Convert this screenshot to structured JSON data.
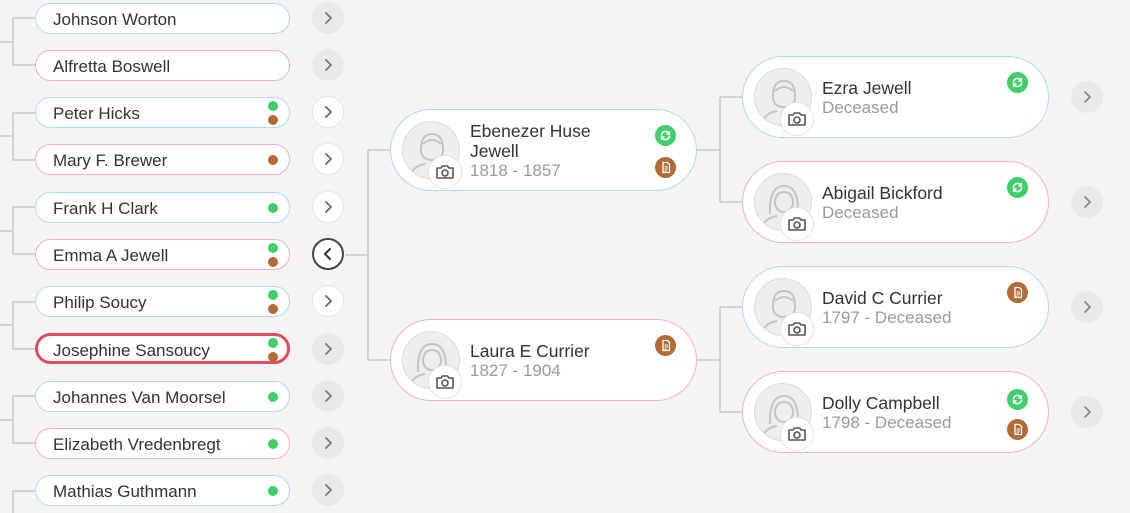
{
  "left_list": [
    {
      "name": "Johnson Worton",
      "gender": "male",
      "dots": [],
      "chevron": "gray"
    },
    {
      "name": "Alfretta Boswell",
      "gender": "female",
      "dots": [],
      "chevron": "gray"
    },
    {
      "name": "Peter Hicks",
      "gender": "male",
      "dots": [
        "green",
        "brown"
      ],
      "chevron": "white"
    },
    {
      "name": "Mary F. Brewer",
      "gender": "female",
      "dots": [
        "brown"
      ],
      "chevron": "white"
    },
    {
      "name": "Frank H Clark",
      "gender": "male",
      "dots": [
        "green"
      ],
      "chevron": "white"
    },
    {
      "name": "Emma A Jewell",
      "gender": "female",
      "dots": [
        "green",
        "brown"
      ],
      "chevron": "active"
    },
    {
      "name": "Philip Soucy",
      "gender": "male",
      "dots": [
        "green",
        "brown"
      ],
      "chevron": "white"
    },
    {
      "name": "Josephine Sansoucy",
      "gender": "female",
      "dots": [
        "green",
        "brown"
      ],
      "chevron": "gray",
      "selected": true
    },
    {
      "name": "Johannes Van Moorsel",
      "gender": "male",
      "dots": [
        "green"
      ],
      "chevron": "gray"
    },
    {
      "name": "Elizabeth Vredenbregt",
      "gender": "female",
      "dots": [
        "green"
      ],
      "chevron": "gray"
    },
    {
      "name": "Mathias Guthmann",
      "gender": "male",
      "dots": [
        "green"
      ],
      "chevron": "gray"
    }
  ],
  "parents": {
    "father": {
      "name": "Ebenezer Huse Jewell",
      "dates": "1818 - 1857"
    },
    "mother": {
      "name": "Laura E Currier",
      "dates": "1827 - 1904"
    }
  },
  "grandparents": {
    "paternal_grandfather": {
      "name": "Ezra Jewell",
      "dates": "Deceased"
    },
    "paternal_grandmother": {
      "name": "Abigail Bickford",
      "dates": "Deceased"
    },
    "maternal_grandfather": {
      "name": "David C Currier",
      "dates": "1797 - Deceased"
    },
    "maternal_grandmother": {
      "name": "Dolly Campbell",
      "dates": "1798 - Deceased"
    }
  },
  "icons": {
    "chevron_right": "chevron-right-icon",
    "chevron_left": "chevron-left-icon",
    "camera": "camera-icon",
    "sync": "sync-icon",
    "document": "document-icon"
  },
  "colors": {
    "male_border": "#aedcea",
    "female_border": "#f1b3b9",
    "selected_border": "#e24b5e",
    "record_hint": "#3fce6b",
    "source_doc": "#b26a36"
  }
}
